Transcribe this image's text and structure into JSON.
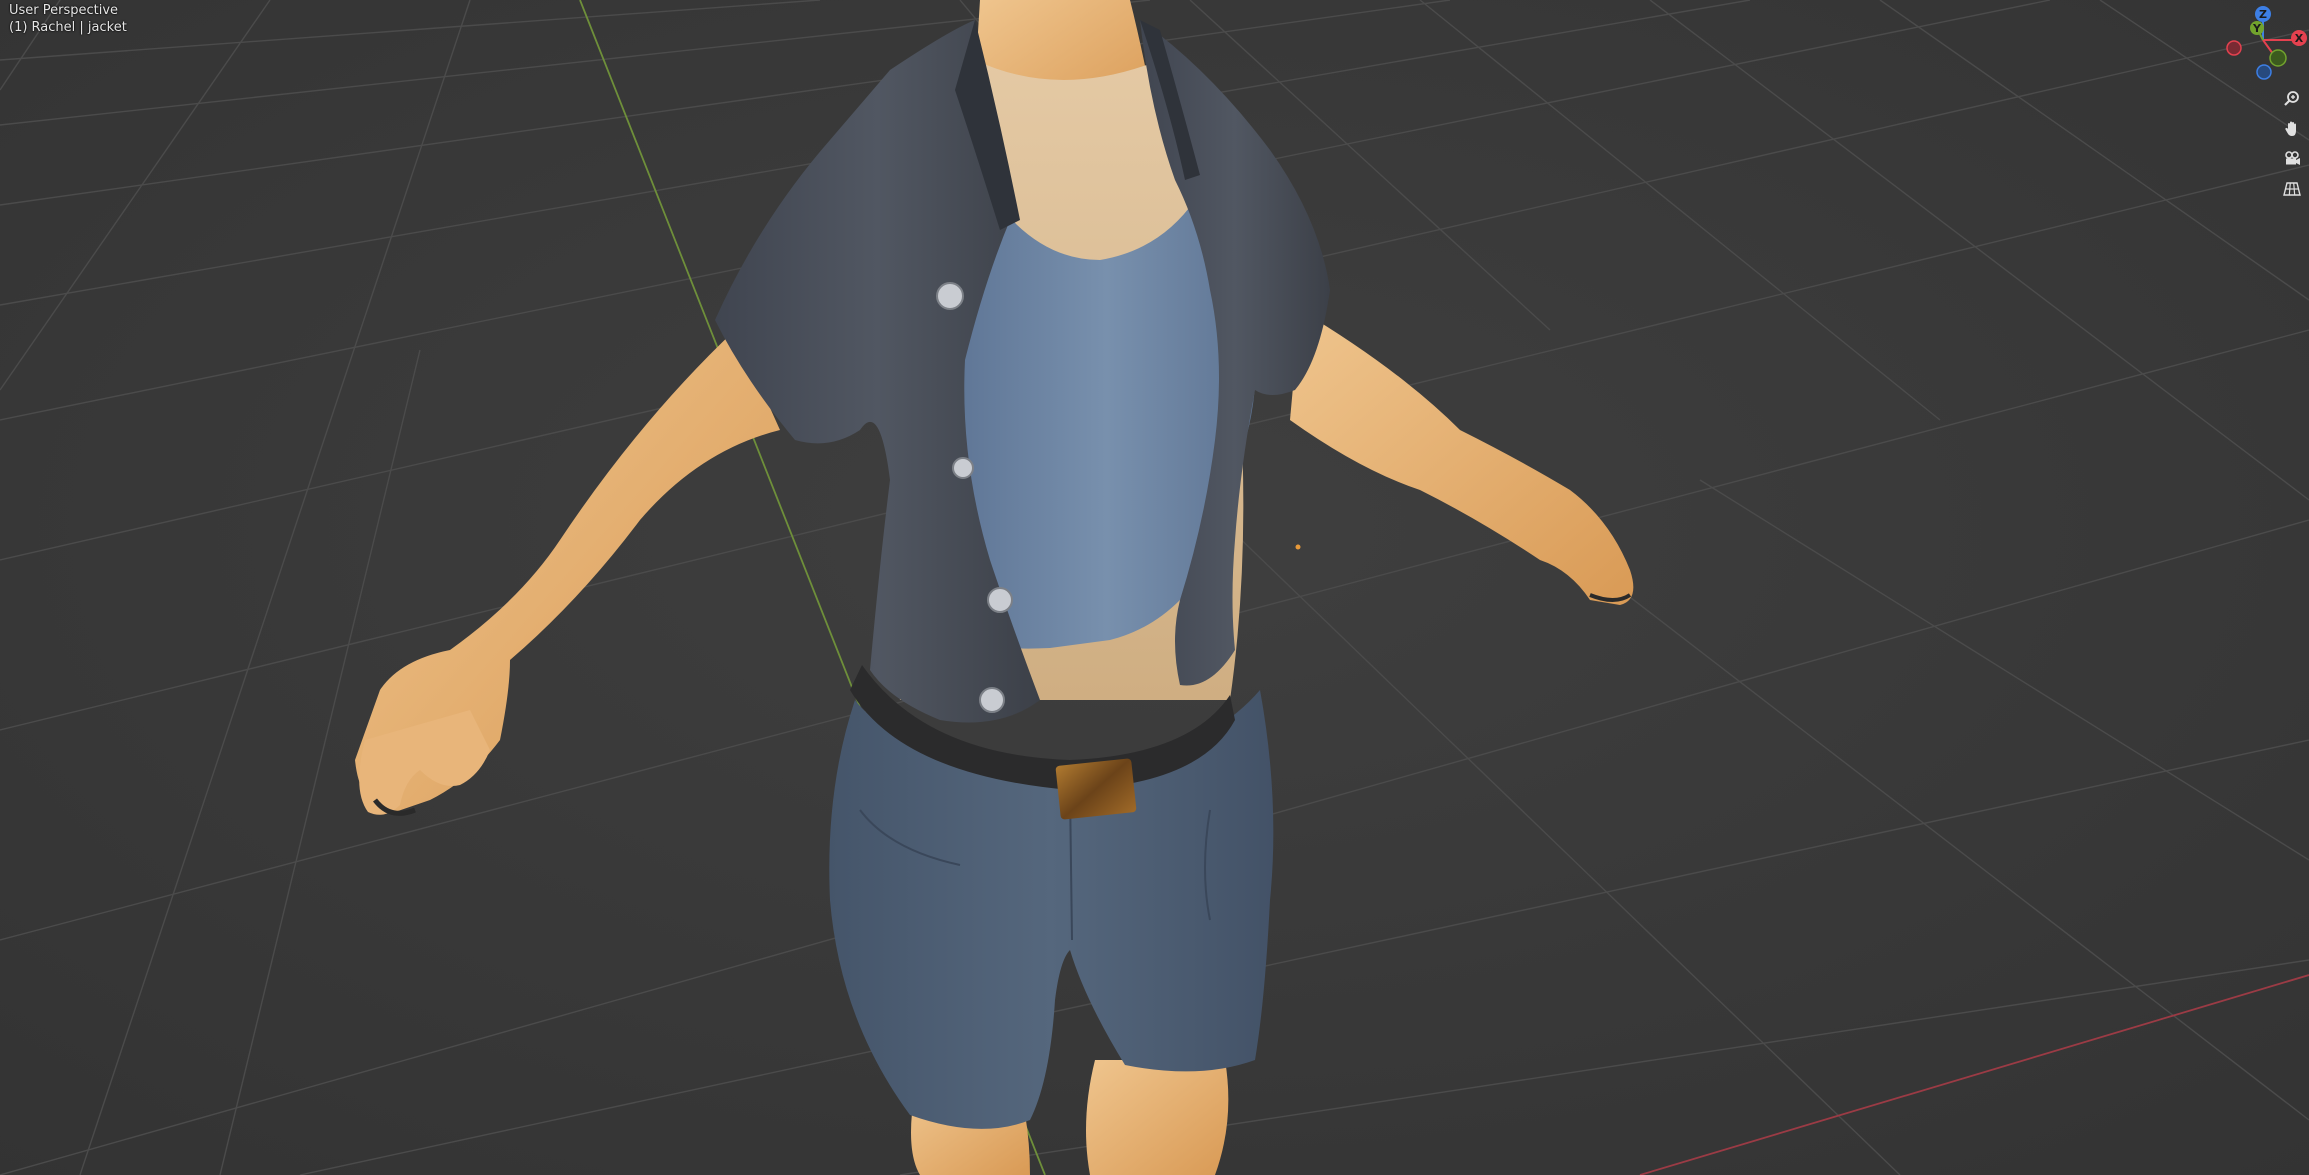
{
  "viewport": {
    "view_name": "User Perspective",
    "object_info": "(1) Rachel | jacket"
  },
  "gizmo": {
    "axes": [
      {
        "label": "X",
        "color": "#e4414f"
      },
      {
        "label": "Y",
        "color": "#72a32d"
      },
      {
        "label": "Z",
        "color": "#3d7fe5"
      }
    ]
  },
  "navigation": {
    "buttons": [
      {
        "name": "zoom",
        "icon": "magnifier-icon"
      },
      {
        "name": "pan",
        "icon": "hand-icon"
      },
      {
        "name": "camera",
        "icon": "camera-icon"
      },
      {
        "name": "orthographic",
        "icon": "grid-icon"
      }
    ]
  },
  "colors": {
    "background": "#3a3a3a",
    "grid_line": "#4a4a4a",
    "x_axis": "#b0404b",
    "y_axis": "#7fa23a",
    "skin": "#e0a868",
    "jacket": "#4a4f57",
    "top": "#6d84a3",
    "shorts": "#4c5d72",
    "belt": "#2b2b2c",
    "buckle": "#8a5a22"
  }
}
